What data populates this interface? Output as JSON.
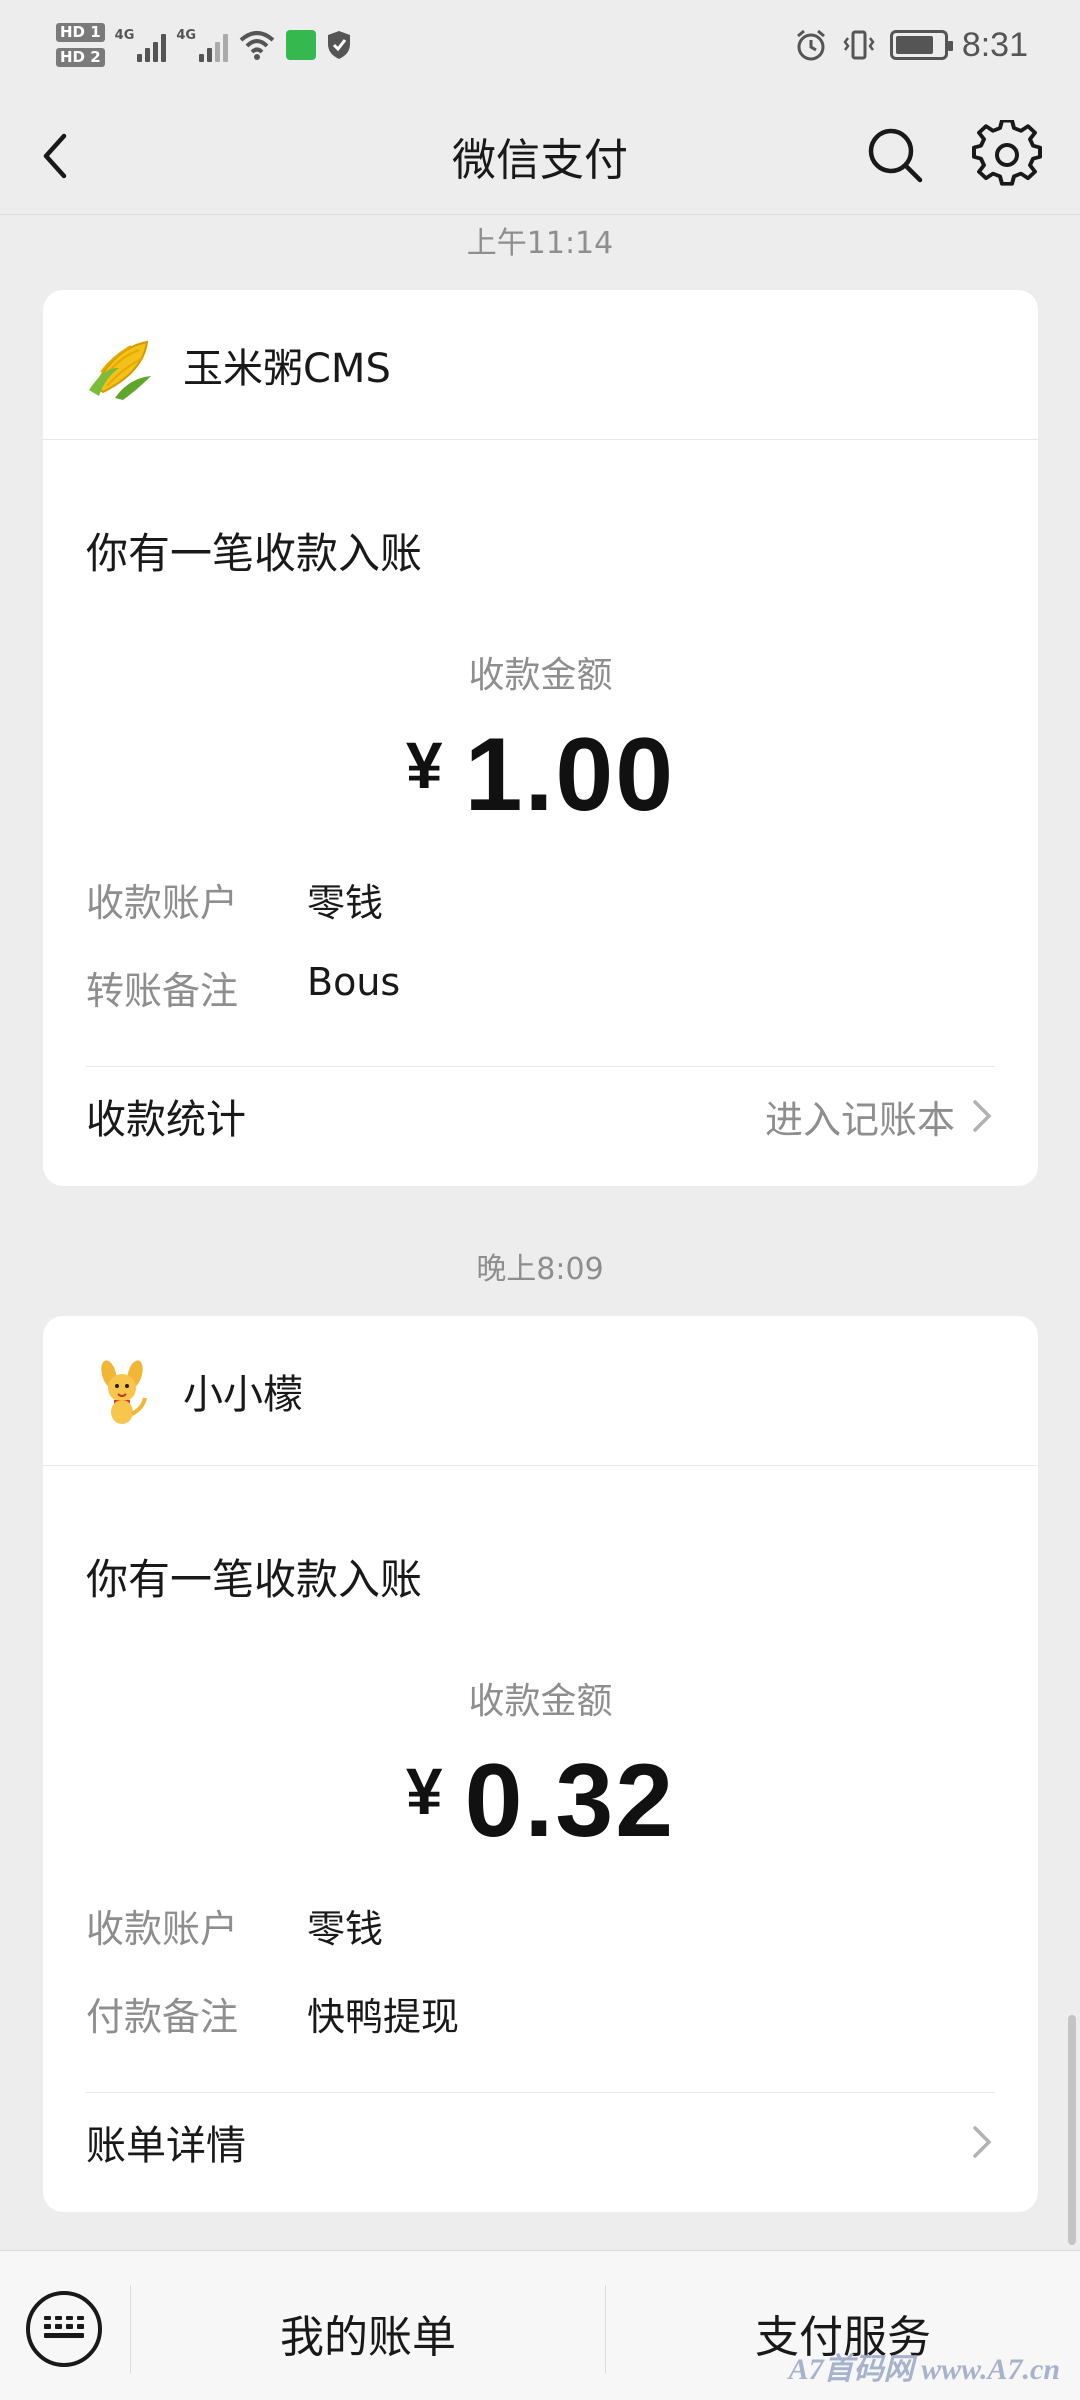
{
  "status_bar": {
    "hd1": "HD 1",
    "hd2": "HD 2",
    "net1": "4G",
    "net2": "4G",
    "time": "8:31",
    "battery_level": 0.8,
    "icons": [
      "signal-icon",
      "wifi-icon",
      "shield-icon",
      "alarm-icon",
      "vibrate-icon",
      "battery-icon"
    ]
  },
  "nav": {
    "title": "微信支付",
    "back_icon": "chevron-left-icon",
    "search_icon": "search-icon",
    "settings_icon": "gear-icon"
  },
  "messages": [
    {
      "time": "上午11:14",
      "merchant": "玉米粥CMS",
      "headline": "你有一笔收款入账",
      "amount_label": "收款金额",
      "currency": "¥",
      "amount": "1.00",
      "rows": [
        {
          "key": "收款账户",
          "value": "零钱"
        },
        {
          "key": "转账备注",
          "value": "Bous"
        }
      ],
      "footer_left": "收款统计",
      "footer_right": "进入记账本"
    },
    {
      "time": "晚上8:09",
      "merchant": "小小檬",
      "headline": "你有一笔收款入账",
      "amount_label": "收款金额",
      "currency": "¥",
      "amount": "0.32",
      "rows": [
        {
          "key": "收款账户",
          "value": "零钱"
        },
        {
          "key": "付款备注",
          "value": "快鸭提现"
        }
      ],
      "footer_left": "账单详情",
      "footer_right": ""
    }
  ],
  "bottom_bar": {
    "keyboard_icon": "keyboard-icon",
    "item1": "我的账单",
    "item2": "支付服务"
  },
  "watermark": "A7首码网 www.A7.cn",
  "colors": {
    "background": "#ededed",
    "card": "#ffffff",
    "muted_text": "#8e8e8e",
    "primary_text": "#191919"
  }
}
